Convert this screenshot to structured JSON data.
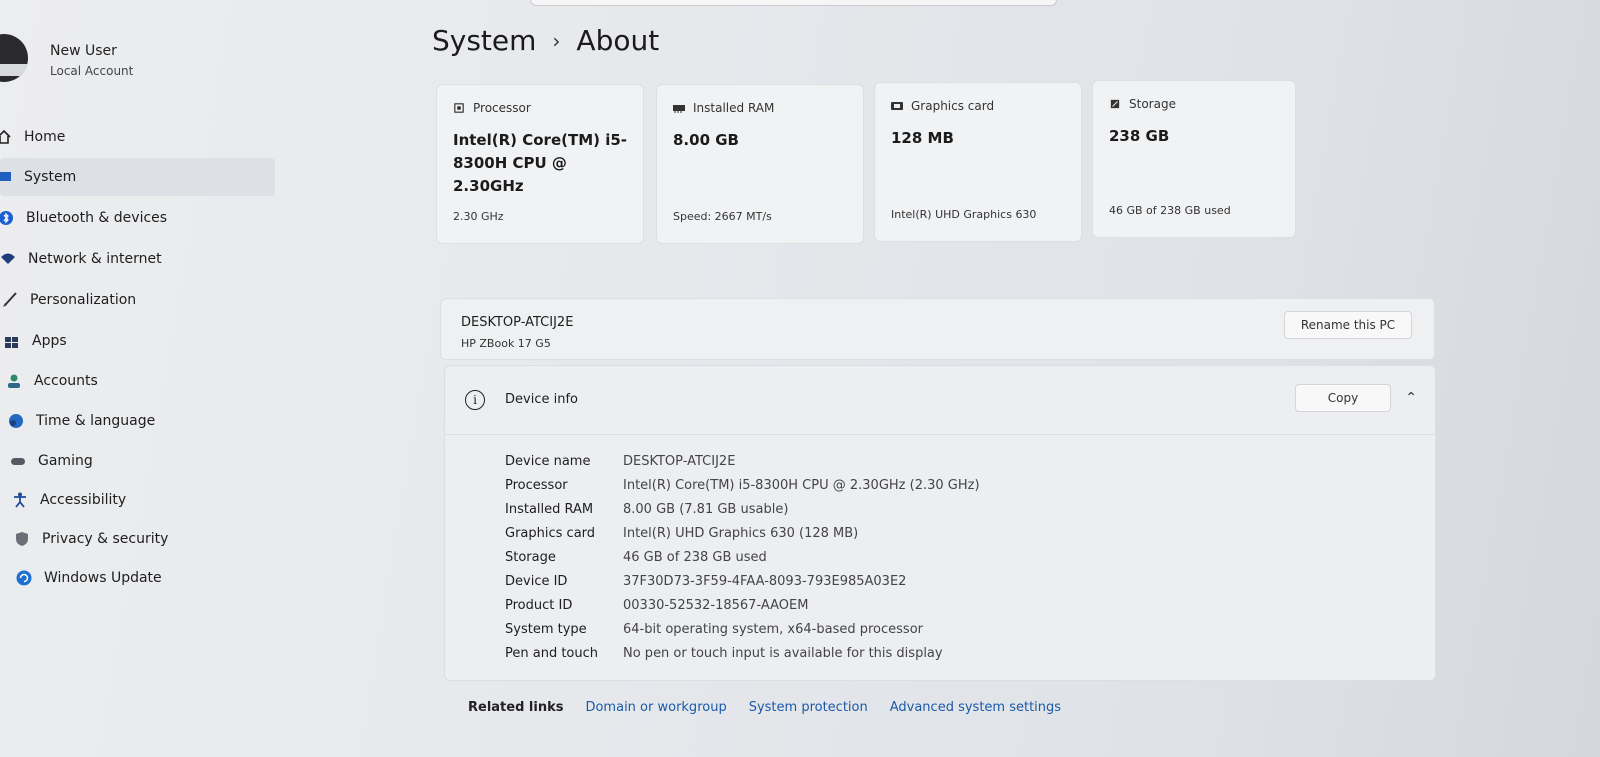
{
  "user": {
    "name": "New User",
    "account_type": "Local Account"
  },
  "nav": {
    "items": [
      {
        "label": "Home",
        "icon": "home-icon"
      },
      {
        "label": "System",
        "icon": "system-icon"
      },
      {
        "label": "Bluetooth & devices",
        "icon": "bluetooth-icon"
      },
      {
        "label": "Network & internet",
        "icon": "wifi-icon"
      },
      {
        "label": "Personalization",
        "icon": "brush-icon"
      },
      {
        "label": "Apps",
        "icon": "apps-icon"
      },
      {
        "label": "Accounts",
        "icon": "person-icon"
      },
      {
        "label": "Time & language",
        "icon": "globe-clock-icon"
      },
      {
        "label": "Gaming",
        "icon": "gamepad-icon"
      },
      {
        "label": "Accessibility",
        "icon": "accessibility-icon"
      },
      {
        "label": "Privacy & security",
        "icon": "shield-icon"
      },
      {
        "label": "Windows Update",
        "icon": "update-icon"
      }
    ],
    "active": "System"
  },
  "header": {
    "section": "System",
    "separator": "›",
    "page": "About"
  },
  "cards": [
    {
      "title": "Processor",
      "value": "Intel(R) Core(TM) i5-8300H CPU @ 2.30GHz",
      "sub": "2.30 GHz",
      "icon": "processor-icon"
    },
    {
      "title": "Installed RAM",
      "value": "8.00 GB",
      "sub": "Speed: 2667 MT/s",
      "icon": "ram-icon"
    },
    {
      "title": "Graphics card",
      "value": "128 MB",
      "sub": "Intel(R) UHD Graphics 630",
      "icon": "graphics-card-icon"
    },
    {
      "title": "Storage",
      "value": "238 GB",
      "sub": "46 GB of 238 GB used",
      "icon": "storage-icon"
    }
  ],
  "pc": {
    "name": "DESKTOP-ATCIJ2E",
    "model": "HP ZBook 17 G5",
    "rename_label": "Rename this PC"
  },
  "device_info": {
    "title": "Device info",
    "copy_label": "Copy",
    "rows": [
      {
        "key": "Device name",
        "value": "DESKTOP-ATCIJ2E"
      },
      {
        "key": "Processor",
        "value": "Intel(R) Core(TM) i5-8300H CPU @ 2.30GHz (2.30 GHz)"
      },
      {
        "key": "Installed RAM",
        "value": "8.00 GB (7.81 GB usable)"
      },
      {
        "key": "Graphics card",
        "value": "Intel(R) UHD Graphics 630 (128 MB)"
      },
      {
        "key": "Storage",
        "value": "46 GB of 238 GB used"
      },
      {
        "key": "Device ID",
        "value": "37F30D73-3F59-4FAA-8093-793E985A03E2"
      },
      {
        "key": "Product ID",
        "value": "00330-52532-18567-AAOEM"
      },
      {
        "key": "System type",
        "value": "64-bit operating system, x64-based processor"
      },
      {
        "key": "Pen and touch",
        "value": "No pen or touch input is available for this display"
      }
    ]
  },
  "related": {
    "title": "Related links",
    "links": [
      "Domain or workgroup",
      "System protection",
      "Advanced system settings"
    ]
  },
  "colors": {
    "accent": "#0067c0",
    "link": "#1a5aa8",
    "active_nav": "#dde0e5"
  }
}
